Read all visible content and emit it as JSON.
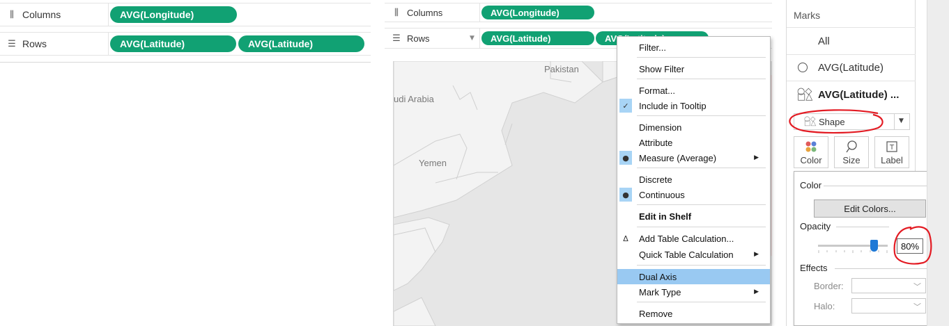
{
  "panel1": {
    "columns_label": "Columns",
    "rows_label": "Rows",
    "columns_pills": [
      "AVG(Longitude)"
    ],
    "rows_pills": [
      "AVG(Latitude)",
      "AVG(Latitude)"
    ]
  },
  "panel2": {
    "columns_label": "Columns",
    "rows_label": "Rows",
    "columns_pills": [
      "AVG(Longitude)"
    ],
    "rows_pills": [
      "AVG(Latitude)",
      "AVG(Latitude)"
    ],
    "map_labels": [
      "Pakistan",
      "udi Arabia",
      "Yemen"
    ],
    "context_menu": {
      "items": [
        {
          "label": "Filter..."
        },
        {
          "label": "Show Filter"
        },
        {
          "label": "Format..."
        },
        {
          "label": "Include in Tooltip",
          "mark": "check"
        },
        {
          "label": "Dimension"
        },
        {
          "label": "Attribute"
        },
        {
          "label": "Measure (Average)",
          "mark": "dot",
          "submenu": true
        },
        {
          "label": "Discrete"
        },
        {
          "label": "Continuous",
          "mark": "dot"
        },
        {
          "label": "Edit in Shelf",
          "bold": true
        },
        {
          "label": "Add Table Calculation...",
          "mark": "delta"
        },
        {
          "label": "Quick Table Calculation",
          "submenu": true
        },
        {
          "label": "Dual Axis",
          "highlighted": true
        },
        {
          "label": "Mark Type",
          "submenu": true
        },
        {
          "label": "Remove"
        }
      ]
    }
  },
  "panel3": {
    "marks_title": "Marks",
    "all_label": "All",
    "layer1_label": "AVG(Latitude)",
    "layer2_label": "AVG(Latitude) ...",
    "mark_type_value": "Shape",
    "cards": {
      "color": "Color",
      "size": "Size",
      "label": "Label"
    },
    "popup": {
      "color_section": "Color",
      "edit_colors_button": "Edit Colors...",
      "opacity_section": "Opacity",
      "opacity_value": "80%",
      "opacity_level": 0.8,
      "effects_section": "Effects",
      "border_label": "Border:",
      "halo_label": "Halo:"
    }
  },
  "colors": {
    "pill_green": "#11a173",
    "menu_highlight": "#99c9f2",
    "annotation_red": "#e31b23",
    "slider_blue": "#1f79d6"
  }
}
